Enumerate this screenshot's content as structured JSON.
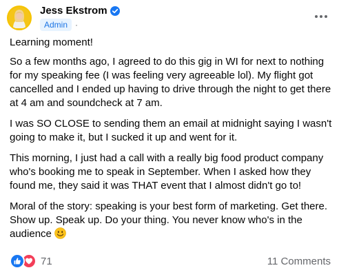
{
  "author": {
    "name": "Jess Ekstrom",
    "role_badge": "Admin",
    "separator": "·"
  },
  "post": {
    "paragraphs": [
      "Learning moment!",
      "So a few months ago, I agreed to do this gig in WI for next to nothing for my speaking fee (I was feeling very agreeable lol). My flight got cancelled and I ended up having to drive through the night to get there at 4 am and soundcheck at 7 am.",
      "I was SO CLOSE to sending them an email at midnight saying I wasn't going to make it, but I sucked it up and went for it.",
      "This morning, I just had a call with a really big food product company who's booking me to speak in September. When I asked how they found me, they said it was THAT event that I almost didn't go to!",
      "Moral of the story: speaking is your best form of marketing. Get there. Show up. Speak up. Do your thing. You never know who's in the audience"
    ],
    "closing_emoji": "smiling-face-emoji"
  },
  "footer": {
    "reaction_count": "71",
    "comments_label": "11 Comments",
    "reaction_icons": [
      "like-icon",
      "love-icon"
    ]
  },
  "colors": {
    "accent_blue": "#1877f2",
    "love_red": "#f33e58",
    "secondary_text": "#65676b",
    "badge_bg": "#e7f3ff",
    "badge_text": "#1b74e4"
  },
  "icons": {
    "verified": "verified-badge-icon",
    "more": "more-options-icon",
    "globe": "globe-icon"
  }
}
